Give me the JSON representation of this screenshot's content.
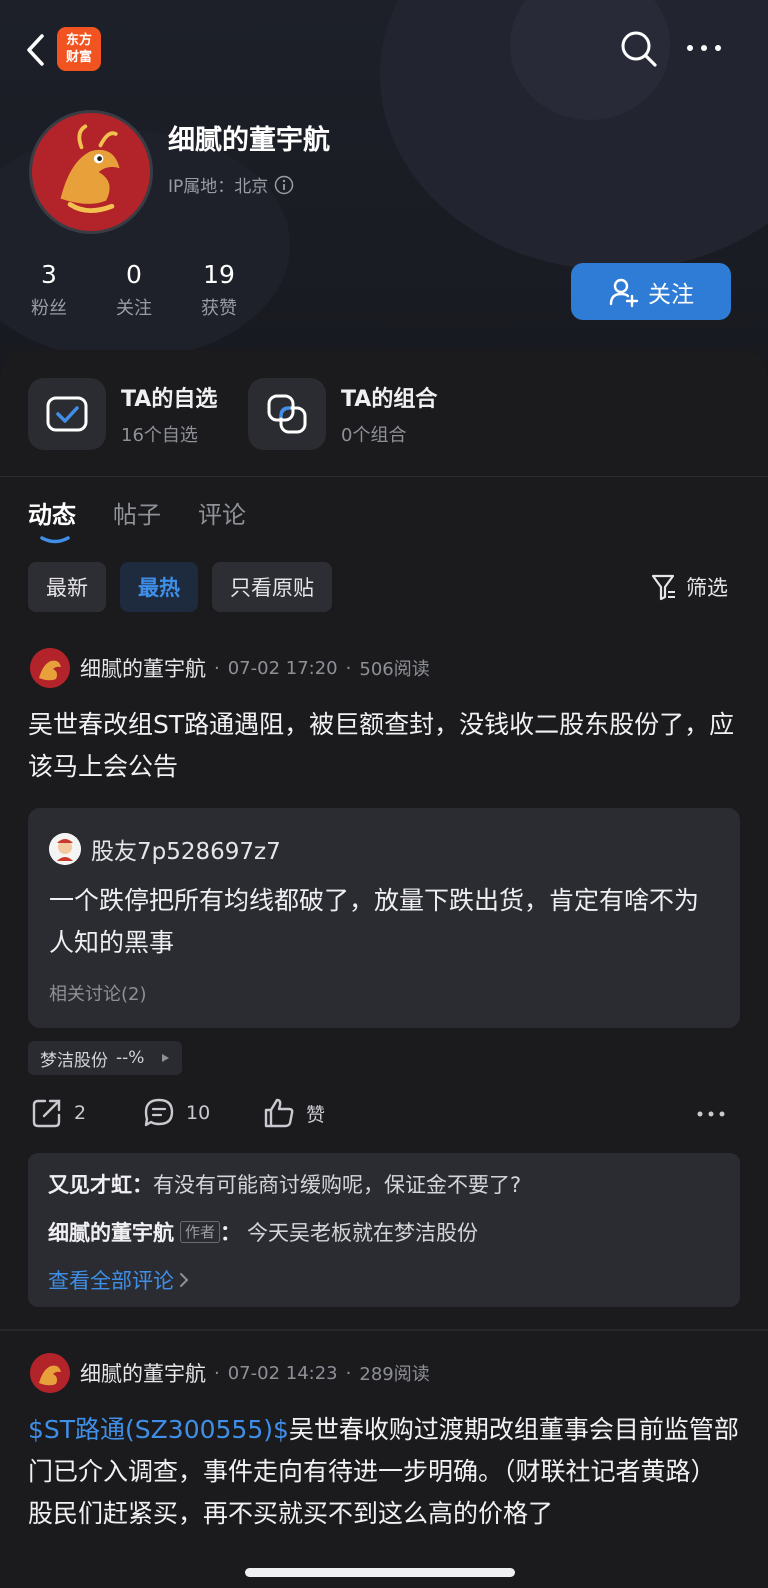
{
  "header": {
    "logo_line1": "东方",
    "logo_line2": "财富",
    "nickname": "细腻的董宇航",
    "ip_label": "IP属地：北京",
    "stats": [
      {
        "num": "3",
        "label": "粉丝"
      },
      {
        "num": "0",
        "label": "关注"
      },
      {
        "num": "19",
        "label": "获赞"
      }
    ],
    "follow_label": "关注"
  },
  "entries": [
    {
      "title": "TA的自选",
      "sub": "16个自选"
    },
    {
      "title": "TA的组合",
      "sub": "0个组合"
    }
  ],
  "tabs": [
    "动态",
    "帖子",
    "评论"
  ],
  "filters": [
    "最新",
    "最热",
    "只看原贴"
  ],
  "filter_active_index": 1,
  "screen_label": "筛选",
  "posts": [
    {
      "author": "细腻的董宇航",
      "time": "07-02 17:20",
      "reads": "506阅读",
      "body": "吴世春改组ST路通遇阻，被巨额查封，没钱收二股东股份了，应该马上会公告",
      "quote": {
        "user": "股友7p528697z7",
        "text": "一个跌停把所有均线都破了，放量下跌出货，肯定有啥不为人知的黑事",
        "related": "相关讨论(2)"
      },
      "stock_tag": {
        "name": "梦洁股份",
        "change": "--%"
      },
      "actions": {
        "share": "2",
        "comment": "10",
        "like": "赞"
      },
      "comments": [
        {
          "user": "又见才虹",
          "sep": "：",
          "text": "有没有可能商讨缓购呢，保证金不要了?"
        },
        {
          "user": "细腻的董宇航",
          "badge": "作者",
          "sep": "：",
          "text": "今天吴老板就在梦洁股份"
        }
      ],
      "view_all": "查看全部评论"
    },
    {
      "author": "细腻的董宇航",
      "time": "07-02 14:23",
      "reads": "289阅读",
      "stock_link": "$ST路通(SZ300555)$",
      "body": "吴世春收购过渡期改组董事会目前监管部门已介入调查，事件走向有待进一步明确。（财联社记者黄路）股民们赶紧买，再不买就买不到这么高的价格了"
    }
  ],
  "colors": {
    "accent": "#2f7cd6",
    "link": "#3f8fe8",
    "logo": "#f25421",
    "background": "#161617",
    "card": "#2b2c31"
  },
  "icons": [
    "back-icon",
    "search-icon",
    "more-icon",
    "info-icon",
    "user-plus-icon",
    "checkbox-icon",
    "combination-icon",
    "funnel-icon",
    "share-icon",
    "comment-icon",
    "like-icon",
    "dots-icon",
    "chevron-right-icon"
  ]
}
